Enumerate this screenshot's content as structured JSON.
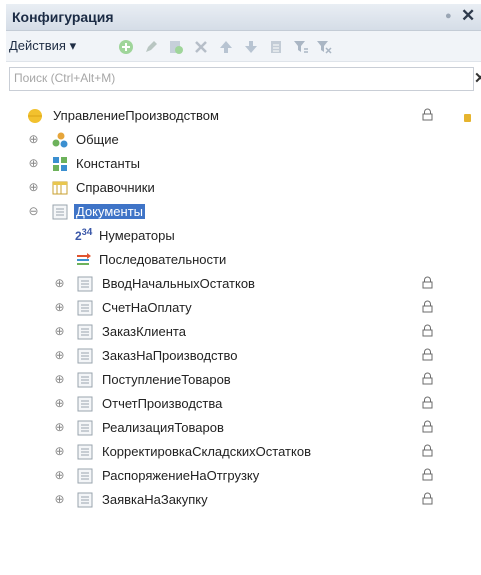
{
  "window": {
    "title": "Конфигурация"
  },
  "toolbar": {
    "actions_label": "Действия ▾",
    "buttons": [
      "add-icon",
      "edit-icon",
      "copy-icon",
      "delete-icon",
      "move-up-icon",
      "move-down-icon",
      "properties-icon",
      "filter-icon",
      "filter-clear-icon"
    ]
  },
  "search": {
    "placeholder": "Поиск (Ctrl+Alt+M)",
    "value": ""
  },
  "tree": {
    "root": "УправлениеПроизводством",
    "groups": [
      "Общие",
      "Константы",
      "Справочники"
    ],
    "documents_label": "Документы",
    "doc_children": [
      "Нумераторы",
      "Последовательности"
    ],
    "doc_items": [
      "ВводНачальныхОстатков",
      "СчетНаОплату",
      "ЗаказКлиента",
      "ЗаказНаПроизводство",
      "ПоступлениеТоваров",
      "ОтчетПроизводства",
      "РеализацияТоваров",
      "КорректировкаСкладскихОстатков",
      "РаспоряжениеНаОтгрузку",
      "ЗаявкаНаЗакупку"
    ]
  },
  "colors": {
    "selection": "#3f74c7",
    "root_icon": "#f2c12e"
  }
}
